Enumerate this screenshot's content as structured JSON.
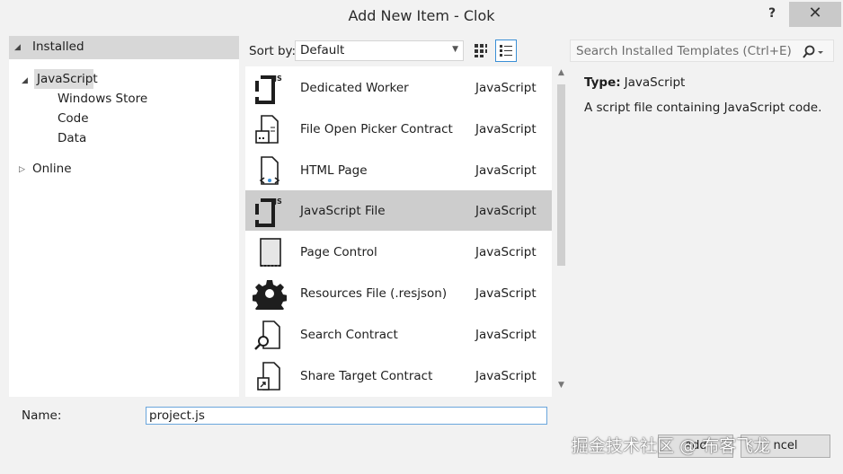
{
  "window": {
    "title": "Add New Item - Clok",
    "help_label": "?",
    "close_label": "✕"
  },
  "tree": {
    "installed_label": "Installed",
    "javascript_label": "JavaScript",
    "children": [
      "Windows Store",
      "Code",
      "Data"
    ],
    "online_label": "Online"
  },
  "toolbar": {
    "sort_label": "Sort by:",
    "sort_value": "Default",
    "search_placeholder": "Search Installed Templates (Ctrl+E)"
  },
  "templates": [
    {
      "name": "Dedicated Worker",
      "type": "JavaScript",
      "icon": "js-file-icon"
    },
    {
      "name": "File Open Picker Contract",
      "type": "JavaScript",
      "icon": "picker-contract-icon"
    },
    {
      "name": "HTML Page",
      "type": "JavaScript",
      "icon": "html-page-icon"
    },
    {
      "name": "JavaScript File",
      "type": "JavaScript",
      "icon": "js-file-icon"
    },
    {
      "name": "Page Control",
      "type": "JavaScript",
      "icon": "page-control-icon"
    },
    {
      "name": "Resources File (.resjson)",
      "type": "JavaScript",
      "icon": "gear-icon"
    },
    {
      "name": "Search Contract",
      "type": "JavaScript",
      "icon": "search-contract-icon"
    },
    {
      "name": "Share Target Contract",
      "type": "JavaScript",
      "icon": "share-contract-icon"
    }
  ],
  "selected_index": 3,
  "details": {
    "type_label": "Type:",
    "type_value": "JavaScript",
    "description": "A script file containing JavaScript code."
  },
  "name_field": {
    "label": "Name:",
    "value": "project.js"
  },
  "buttons": {
    "add_label": "Add",
    "cancel_label": "ncel"
  },
  "watermark": "掘金技术社区 @ 布客飞龙",
  "colors": {
    "accent": "#3a8fd6",
    "selection": "#cdcdcd",
    "dialog_bg": "#f2f2f2"
  }
}
